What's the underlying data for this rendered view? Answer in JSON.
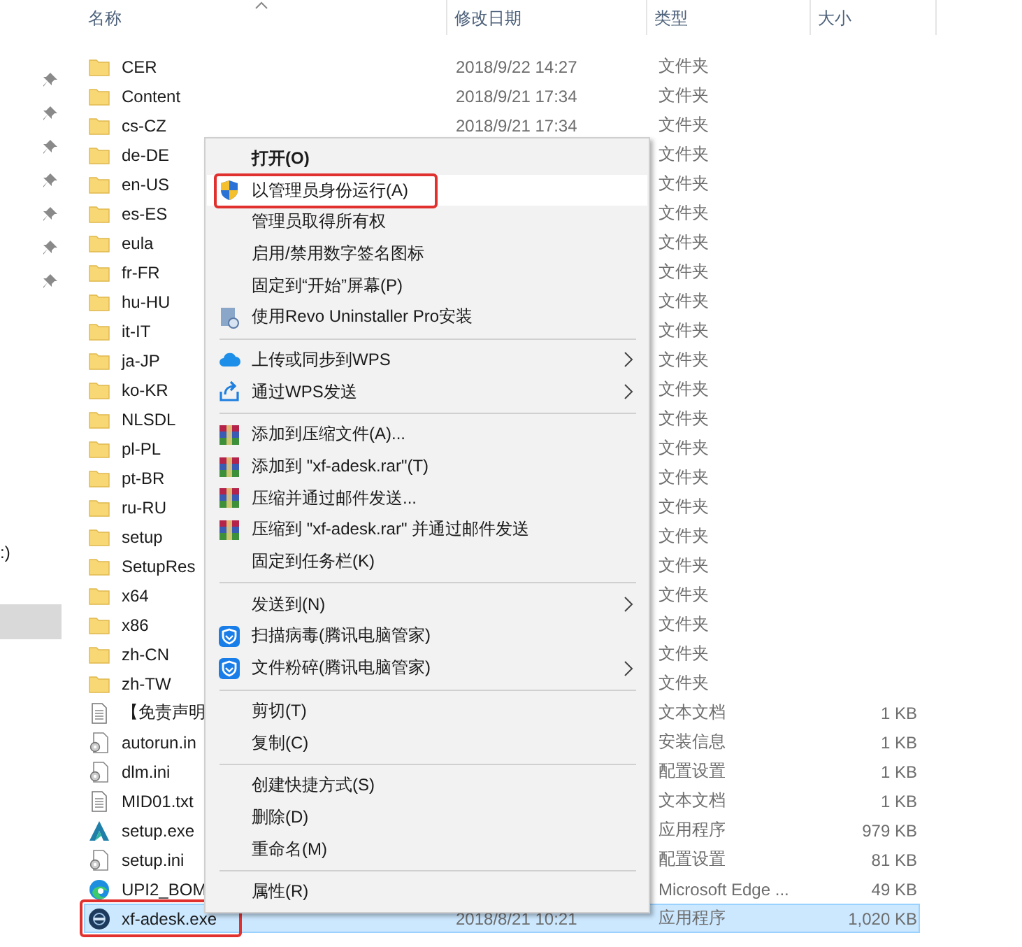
{
  "nav": {
    "items": [
      {
        "kind": "pin"
      },
      {
        "kind": "pin"
      },
      {
        "kind": "pin"
      },
      {
        "kind": "pin"
      },
      {
        "kind": "pin"
      },
      {
        "kind": "pin"
      },
      {
        "kind": "pin"
      },
      {
        "kind": "drive",
        "label": ":)"
      },
      {
        "kind": "blank",
        "selected": true
      }
    ]
  },
  "table": {
    "columns": [
      {
        "label": "名称",
        "sorted": true
      },
      {
        "label": "修改日期",
        "sorted": false
      },
      {
        "label": "类型",
        "sorted": false
      },
      {
        "label": "大小",
        "sorted": false
      }
    ],
    "rows": [
      {
        "kind": "folder",
        "name": "CER",
        "date": "2018/9/22 14:27",
        "type": "文件夹",
        "selected": false,
        "annotated": false
      },
      {
        "kind": "folder",
        "name": "Content",
        "date": "2018/9/21 17:34",
        "type": "文件夹",
        "selected": false,
        "annotated": false
      },
      {
        "kind": "folder",
        "name": "cs-CZ",
        "date": "2018/9/21 17:34",
        "type": "文件夹",
        "selected": false,
        "annotated": false
      },
      {
        "kind": "folder",
        "name": "de-DE",
        "type": "文件夹",
        "selected": false,
        "annotated": false
      },
      {
        "kind": "folder",
        "name": "en-US",
        "type": "文件夹",
        "selected": false,
        "annotated": false
      },
      {
        "kind": "folder",
        "name": "es-ES",
        "type": "文件夹",
        "selected": false,
        "annotated": false
      },
      {
        "kind": "folder",
        "name": "eula",
        "type": "文件夹",
        "selected": false,
        "annotated": false
      },
      {
        "kind": "folder",
        "name": "fr-FR",
        "type": "文件夹",
        "selected": false,
        "annotated": false
      },
      {
        "kind": "folder",
        "name": "hu-HU",
        "type": "文件夹",
        "selected": false,
        "annotated": false
      },
      {
        "kind": "folder",
        "name": "it-IT",
        "type": "文件夹",
        "selected": false,
        "annotated": false
      },
      {
        "kind": "folder",
        "name": "ja-JP",
        "type": "文件夹",
        "selected": false,
        "annotated": false
      },
      {
        "kind": "folder",
        "name": "ko-KR",
        "type": "文件夹",
        "selected": false,
        "annotated": false
      },
      {
        "kind": "folder",
        "name": "NLSDL",
        "type": "文件夹",
        "selected": false,
        "annotated": false
      },
      {
        "kind": "folder",
        "name": "pl-PL",
        "type": "文件夹",
        "selected": false,
        "annotated": false
      },
      {
        "kind": "folder",
        "name": "pt-BR",
        "type": "文件夹",
        "selected": false,
        "annotated": false
      },
      {
        "kind": "folder",
        "name": "ru-RU",
        "type": "文件夹",
        "selected": false,
        "annotated": false
      },
      {
        "kind": "folder",
        "name": "setup",
        "type": "文件夹",
        "selected": false,
        "annotated": false
      },
      {
        "kind": "folder",
        "name": "SetupRes",
        "type": "文件夹",
        "selected": false,
        "annotated": false
      },
      {
        "kind": "folder",
        "name": "x64",
        "type": "文件夹",
        "selected": false,
        "annotated": false
      },
      {
        "kind": "folder",
        "name": "x86",
        "type": "文件夹",
        "selected": false,
        "annotated": false
      },
      {
        "kind": "folder",
        "name": "zh-CN",
        "type": "文件夹",
        "selected": false,
        "annotated": false
      },
      {
        "kind": "folder",
        "name": "zh-TW",
        "type": "文件夹",
        "selected": false,
        "annotated": false
      },
      {
        "kind": "text",
        "name": "【免责声明",
        "type": "文本文档",
        "size": "1 KB",
        "selected": false,
        "annotated": false
      },
      {
        "kind": "settings",
        "name": "autorun.in",
        "type": "安装信息",
        "size": "1 KB",
        "selected": false,
        "annotated": false
      },
      {
        "kind": "settings",
        "name": "dlm.ini",
        "type": "配置设置",
        "size": "1 KB",
        "selected": false,
        "annotated": false
      },
      {
        "kind": "text",
        "name": "MID01.txt",
        "type": "文本文档",
        "size": "1 KB",
        "selected": false,
        "annotated": false
      },
      {
        "kind": "app",
        "name": "setup.exe",
        "type": "应用程序",
        "size": "979 KB",
        "selected": false,
        "annotated": false
      },
      {
        "kind": "settings",
        "name": "setup.ini",
        "type": "配置设置",
        "size": "81 KB",
        "selected": false,
        "annotated": false
      },
      {
        "kind": "browser",
        "name": "UPI2_BOM",
        "type": "Microsoft Edge ...",
        "size": "49 KB",
        "selected": false,
        "annotated": false
      },
      {
        "kind": "disc",
        "name": "xf-adesk.exe",
        "date": "2018/8/21 10:21",
        "type": "应用程序",
        "size": "1,020 KB",
        "selected": true,
        "annotated": true
      }
    ]
  },
  "context_menu": {
    "items": [
      {
        "kind": "plain",
        "label": "打开(O)",
        "default": true,
        "highlighted": false,
        "submenu": false,
        "annotated": false
      },
      {
        "kind": "shield",
        "label": "以管理员身份运行(A)",
        "default": false,
        "highlighted": true,
        "submenu": false,
        "annotated": true
      },
      {
        "kind": "plain",
        "label": "管理员取得所有权",
        "default": false,
        "highlighted": false,
        "submenu": false,
        "annotated": false
      },
      {
        "kind": "plain",
        "label": "启用/禁用数字签名图标",
        "default": false,
        "highlighted": false,
        "submenu": false,
        "annotated": false
      },
      {
        "kind": "plain",
        "label": "固定到“开始”屏幕(P)",
        "default": false,
        "highlighted": false,
        "submenu": false,
        "annotated": false
      },
      {
        "kind": "installer",
        "label": "使用Revo Uninstaller Pro安装",
        "default": false,
        "highlighted": false,
        "submenu": false,
        "annotated": false
      },
      {
        "kind": "separator"
      },
      {
        "kind": "cloud",
        "label": "上传或同步到WPS",
        "default": false,
        "highlighted": false,
        "submenu": true,
        "annotated": false
      },
      {
        "kind": "share",
        "label": "通过WPS发送",
        "default": false,
        "highlighted": false,
        "submenu": true,
        "annotated": false
      },
      {
        "kind": "separator"
      },
      {
        "kind": "archive",
        "label": "添加到压缩文件(A)...",
        "default": false,
        "highlighted": false,
        "submenu": false,
        "annotated": false
      },
      {
        "kind": "archive",
        "label": "添加到 \"xf-adesk.rar\"(T)",
        "default": false,
        "highlighted": false,
        "submenu": false,
        "annotated": false
      },
      {
        "kind": "archive",
        "label": "压缩并通过邮件发送...",
        "default": false,
        "highlighted": false,
        "submenu": false,
        "annotated": false
      },
      {
        "kind": "archive",
        "label": "压缩到 \"xf-adesk.rar\" 并通过邮件发送",
        "default": false,
        "highlighted": false,
        "submenu": false,
        "annotated": false
      },
      {
        "kind": "plain",
        "label": "固定到任务栏(K)",
        "default": false,
        "highlighted": false,
        "submenu": false,
        "annotated": false
      },
      {
        "kind": "separator"
      },
      {
        "kind": "plain",
        "label": "发送到(N)",
        "default": false,
        "highlighted": false,
        "submenu": true,
        "annotated": false
      },
      {
        "kind": "guard",
        "label": "扫描病毒(腾讯电脑管家)",
        "default": false,
        "highlighted": false,
        "submenu": false,
        "annotated": false
      },
      {
        "kind": "guard",
        "label": "文件粉碎(腾讯电脑管家)",
        "default": false,
        "highlighted": false,
        "submenu": true,
        "annotated": false
      },
      {
        "kind": "separator"
      },
      {
        "kind": "plain",
        "label": "剪切(T)",
        "default": false,
        "highlighted": false,
        "submenu": false,
        "annotated": false
      },
      {
        "kind": "plain",
        "label": "复制(C)",
        "default": false,
        "highlighted": false,
        "submenu": false,
        "annotated": false
      },
      {
        "kind": "separator"
      },
      {
        "kind": "plain",
        "label": "创建快捷方式(S)",
        "default": false,
        "highlighted": false,
        "submenu": false,
        "annotated": false
      },
      {
        "kind": "plain",
        "label": "删除(D)",
        "default": false,
        "highlighted": false,
        "submenu": false,
        "annotated": false
      },
      {
        "kind": "plain",
        "label": "重命名(M)",
        "default": false,
        "highlighted": false,
        "submenu": false,
        "annotated": false
      },
      {
        "kind": "separator"
      },
      {
        "kind": "plain",
        "label": "属性(R)",
        "default": false,
        "highlighted": false,
        "submenu": false,
        "annotated": false
      }
    ]
  }
}
